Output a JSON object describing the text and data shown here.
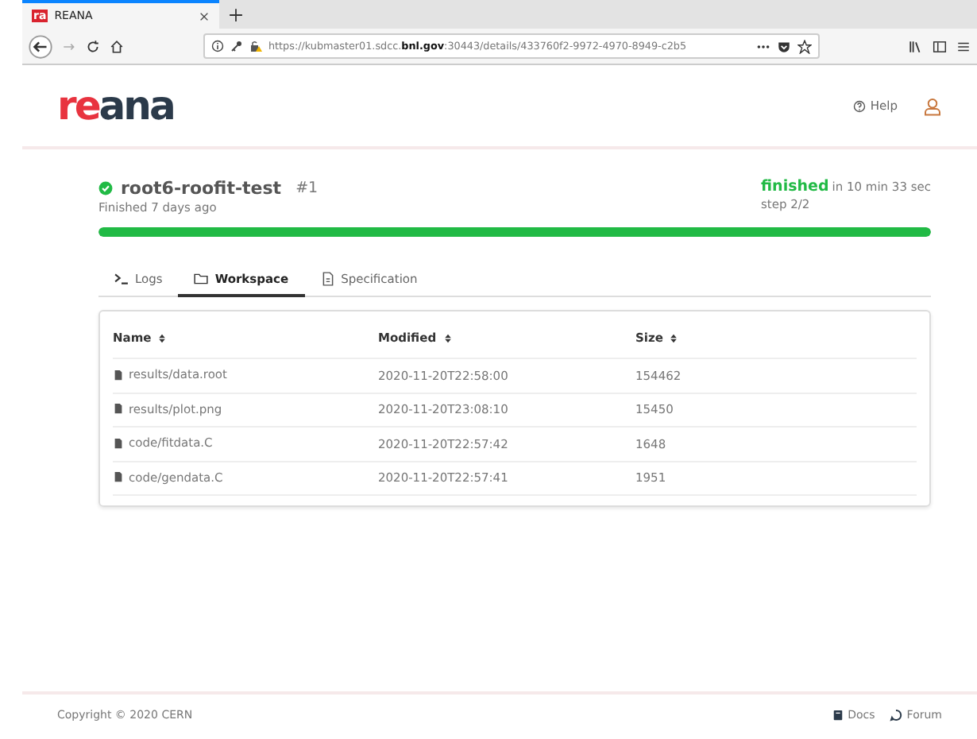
{
  "browser": {
    "favicon": "ra",
    "tab_title": "REANA",
    "url": "https://kubmaster01.sdcc.**bnl.gov**:30443/details/433760f2-9972-4970-8949-c2b5"
  },
  "header": {
    "logo_red": "re",
    "logo_dark": "ana",
    "help": "Help"
  },
  "workflow": {
    "name": "root6-roofit-test",
    "run": "#1",
    "finished_ago": "Finished 7 days ago",
    "status": "finished",
    "duration": "in 10 min 33 sec",
    "step": "step 2/2",
    "level": 1
  },
  "tabs": [
    {
      "label": "Logs",
      "kind": "terminal",
      "selected": false
    },
    {
      "label": "Workspace",
      "kind": "folder",
      "selected": true
    },
    {
      "label": "Specification",
      "kind": "document",
      "selected": false
    }
  ],
  "table": {
    "columns": [
      "Name",
      "Modified",
      "Size"
    ],
    "rows": [
      [
        "results/data.root",
        "2020-11-20T22:58:00",
        "154462"
      ],
      [
        "results/plot.png",
        "2020-11-20T23:08:10",
        "15450"
      ],
      [
        "code/fitdata.C",
        "2020-11-20T22:57:42",
        "1648"
      ],
      [
        "code/gendata.C",
        "2020-11-20T22:57:41",
        "1951"
      ]
    ]
  },
  "footer": {
    "copyright": "Copyright © 2020 CERN",
    "links": [
      "Docs",
      "Forum"
    ]
  }
}
